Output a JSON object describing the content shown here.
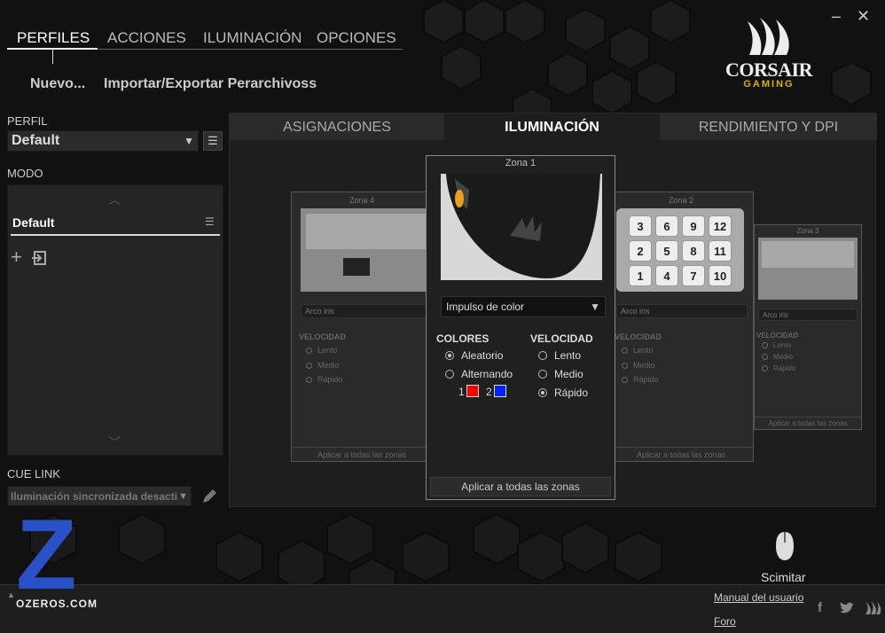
{
  "window": {
    "minimize": "–",
    "close": "✕"
  },
  "topnav": {
    "items": [
      "PERFILES",
      "ACCIONES",
      "ILUMINACIÓN",
      "OPCIONES"
    ]
  },
  "subnav": {
    "new": "Nuevo...",
    "import_export": "Importar/Exportar Perarchivoss"
  },
  "brand": {
    "name": "CORSAIR",
    "sub": "GAMING",
    "accent": "#d8b000"
  },
  "profile": {
    "label": "PERFIL",
    "value": "Default"
  },
  "mode": {
    "label": "MODO",
    "value": "Default"
  },
  "cue_link": {
    "label": "CUE LINK",
    "value": "Iluminación sincronizada desacti"
  },
  "tabs": [
    "ASIGNACIONES",
    "ILUMINACIÓN",
    "RENDIMIENTO Y DPI"
  ],
  "zones": {
    "zone4": {
      "title": "Zona 4",
      "effect": "Arco iris",
      "speed_label": "VELOCIDAD",
      "options": [
        "Lento",
        "Medio",
        "Rápido"
      ],
      "apply": "Aplicar a todas las zonas"
    },
    "zone2": {
      "title": "Zona 2",
      "effect": "Arco iris",
      "speed_label": "VELOCIDAD",
      "options": [
        "Lento",
        "Medio",
        "Rápido"
      ],
      "apply": "Aplicar a todas las zonas",
      "keys": [
        "3",
        "6",
        "9",
        "12",
        "2",
        "5",
        "8",
        "11",
        "1",
        "4",
        "7",
        "10"
      ]
    },
    "zone3": {
      "title": "Zona 3",
      "effect": "Arco iris",
      "speed_label": "VELOCIDAD",
      "options": [
        "Lento",
        "Medio",
        "Rápido"
      ],
      "apply": "Aplicar a todas las zonas"
    },
    "zone1": {
      "title": "Zona 1",
      "effect": "Impulso de color",
      "colors_label": "COLORES",
      "speed_label": "VELOCIDAD",
      "color_options": [
        "Aleatorio",
        "Alternando"
      ],
      "speed_options": [
        "Lento",
        "Medio",
        "Rápido"
      ],
      "color1_num": "1",
      "color1": "#ff0000",
      "color2_num": "2",
      "color2": "#0022ff",
      "apply": "Aplicar a todas las zonas"
    }
  },
  "device": {
    "name": "Scimitar"
  },
  "footer": {
    "manual": "Manual del usuario",
    "forum": "Foro"
  },
  "watermark": {
    "letter": "Z",
    "text": "OZEROS.COM"
  }
}
